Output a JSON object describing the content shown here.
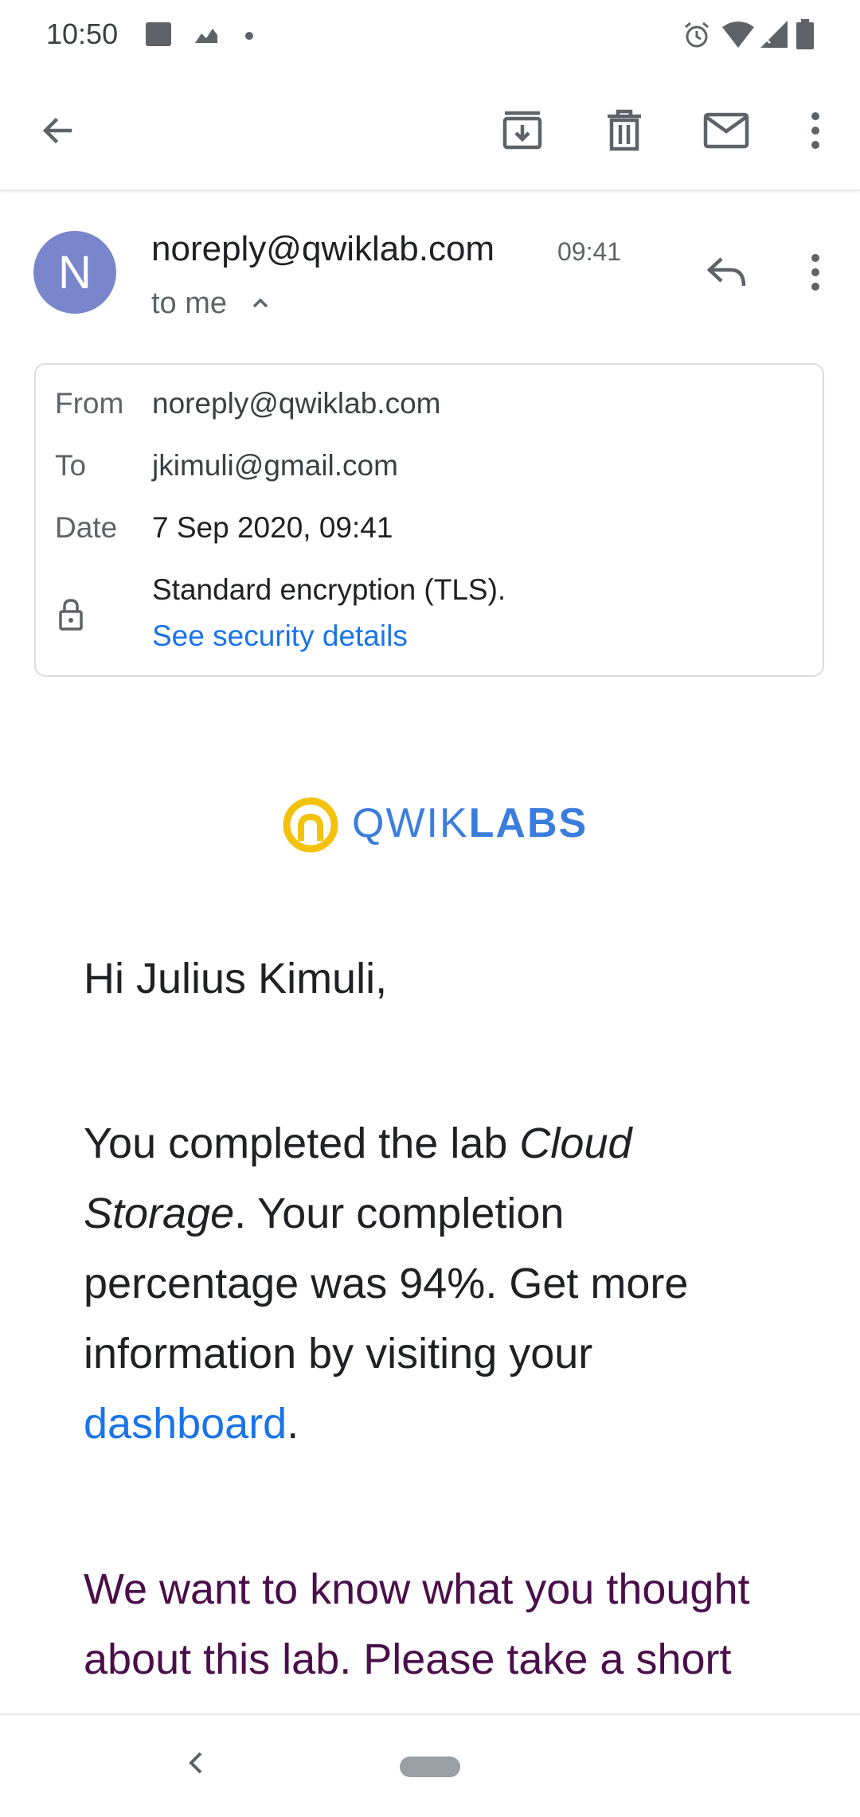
{
  "status_bar": {
    "time": "10:50",
    "icons": [
      "image-icon",
      "chart-icon",
      "dot-icon",
      "alarm-icon",
      "wifi-icon",
      "signal-icon",
      "battery-icon"
    ]
  },
  "toolbar": {
    "icons": [
      "back-arrow-icon",
      "archive-icon",
      "delete-icon",
      "mark-unread-icon",
      "more-vert-icon"
    ]
  },
  "message": {
    "avatar_letter": "N",
    "avatar_color": "#7986cb",
    "sender": "noreply@qwiklab.com",
    "time": "09:41",
    "to_line": "to me"
  },
  "details": {
    "from_label": "From",
    "from_value": "noreply@qwiklab.com",
    "to_label": "To",
    "to_value": "jkimuli@gmail.com",
    "date_label": "Date",
    "date_value": "7 Sep 2020, 09:41",
    "security_text": "Standard encryption (TLS).",
    "security_link": "See security details"
  },
  "body": {
    "logo_light": "QWIK",
    "logo_bold": "LABS",
    "greeting": "Hi Julius Kimuli,",
    "p1_a": "You completed the lab ",
    "p1_lab": "Cloud Storage",
    "p1_b": ". Your completion percentage was 94%. Get more information by visiting your ",
    "p1_link": "dashboard",
    "p1_end": ".",
    "p2": "We want to know what you thought about this lab. Please take a short survey"
  },
  "colors": {
    "link": "#1a73e8",
    "survey_text": "#4a0f4a",
    "logo_yellow": "#f4c20d",
    "logo_blue": "#3b7ddd"
  }
}
